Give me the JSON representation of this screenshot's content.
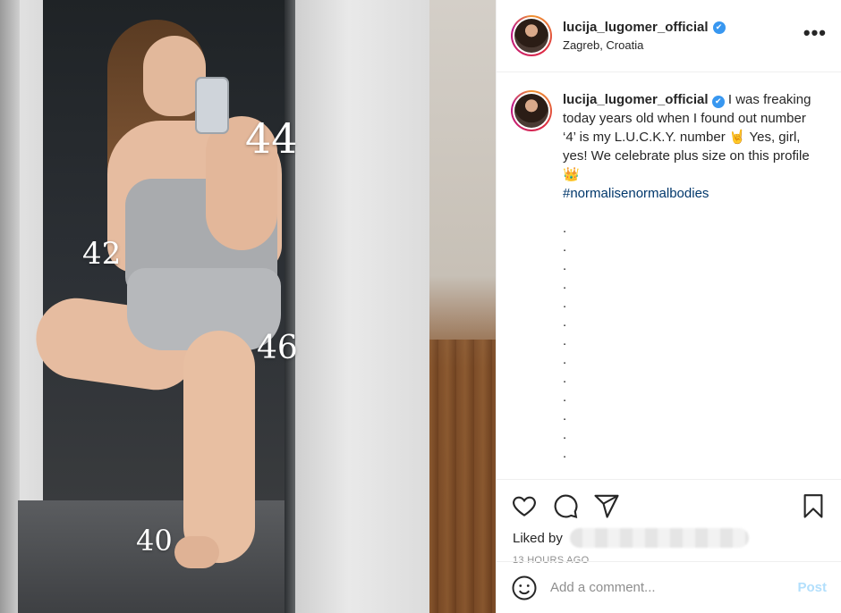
{
  "photo": {
    "labels": [
      "44",
      "42",
      "46",
      "40"
    ]
  },
  "header": {
    "username": "lucija_lugomer_official",
    "verified_icon": "✔",
    "location": "Zagreb, Croatia",
    "more_icon": "•••"
  },
  "caption": {
    "username": "lucija_lugomer_official",
    "verified_icon": "✔",
    "text": " I was freaking today years old when I found out number ‘4’ is my L.U.C.K.Y. number 🤘 Yes, girl, yes! We celebrate plus size on this profile 👑",
    "hashtag": "#normalisenormalbodies",
    "dots": ".\n.\n.\n.\n.\n.\n.\n.\n.\n.\n.\n.\n."
  },
  "actions": {
    "icons": [
      "heart-icon",
      "comment-icon",
      "share-icon",
      "bookmark-icon"
    ],
    "liked_by": "Liked by",
    "timestamp": "13 HOURS AGO"
  },
  "comment": {
    "placeholder": "Add a comment...",
    "post_label": "Post"
  }
}
